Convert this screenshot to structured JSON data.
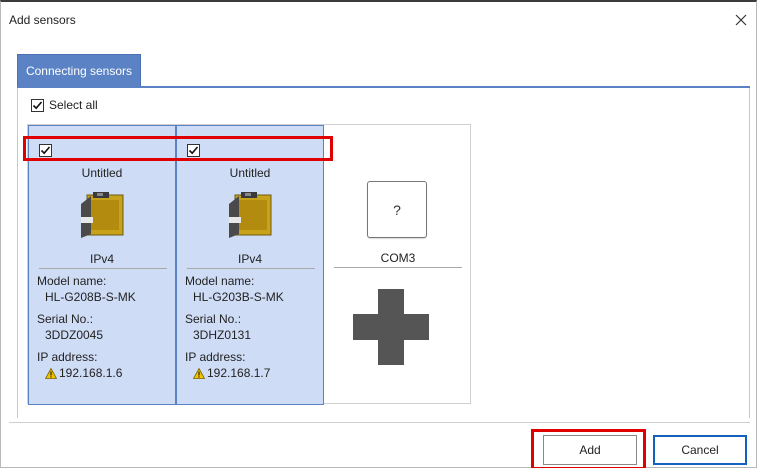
{
  "dialog": {
    "title": "Add sensors",
    "close_icon": "close-icon"
  },
  "tabs": [
    {
      "label": "Connecting sensors",
      "active": true
    }
  ],
  "select_all": {
    "label": "Select all",
    "checked": true
  },
  "sensors": [
    {
      "checked": true,
      "name": "Untitled",
      "protocol": "IPv4",
      "model_label": "Model name:",
      "model": "HL-G208B-S-MK",
      "serial_label": "Serial No.:",
      "serial": "3DDZ0045",
      "ip_label": "IP address:",
      "ip": "192.168.1.6",
      "ip_icon": "warning-icon"
    },
    {
      "checked": true,
      "name": "Untitled",
      "protocol": "IPv4",
      "model_label": "Model name:",
      "model": "HL-G203B-S-MK",
      "serial_label": "Serial No.:",
      "serial": "3DHZ0131",
      "ip_label": "IP address:",
      "ip": "192.168.1.7",
      "ip_icon": "warning-icon"
    }
  ],
  "com_port": {
    "unknown_symbol": "?",
    "label": "COM3",
    "add_icon": "plus-icon"
  },
  "buttons": {
    "add": "Add",
    "cancel": "Cancel"
  },
  "colors": {
    "accent": "#5b82c4",
    "selected_bg": "#cfdcf6",
    "highlight": "#e00000",
    "warning": "#f2c200",
    "primary_border": "#1460c0"
  }
}
